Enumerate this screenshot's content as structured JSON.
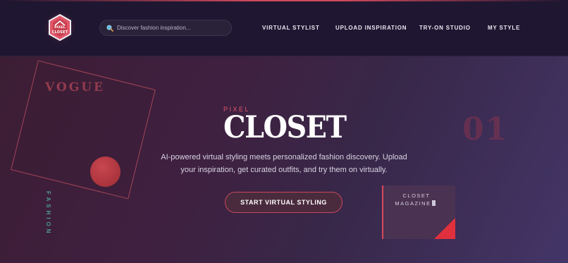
{
  "brand": {
    "logo_line1": "PIXEL",
    "logo_line2": "CLOSET",
    "logo_icon": "hexagon-house-logo"
  },
  "search": {
    "placeholder": "Discover fashion inspiration...",
    "icon": "search-icon"
  },
  "nav": {
    "items": [
      {
        "label": "VIRTUAL STYLIST"
      },
      {
        "label": "UPLOAD INSPIRATION"
      },
      {
        "label": "TRY-ON STUDIO"
      },
      {
        "label": "MY STYLE"
      }
    ]
  },
  "decor": {
    "vogue": "VOGUE",
    "fashion": "FASHION",
    "number": "01"
  },
  "hero": {
    "eyebrow": "PIXEL",
    "title": "CLOSET",
    "description": "AI-powered virtual styling meets personalized fashion discovery. Upload your inspiration, get curated outfits, and try them on virtually.",
    "cta_label": "START VIRTUAL STYLING"
  },
  "magazine": {
    "line1": "CLOSET",
    "line2": "MAGAZINE"
  },
  "colors": {
    "accent": "#e2566a",
    "header_bg": "#1f1631",
    "teal": "#4e9a92"
  }
}
